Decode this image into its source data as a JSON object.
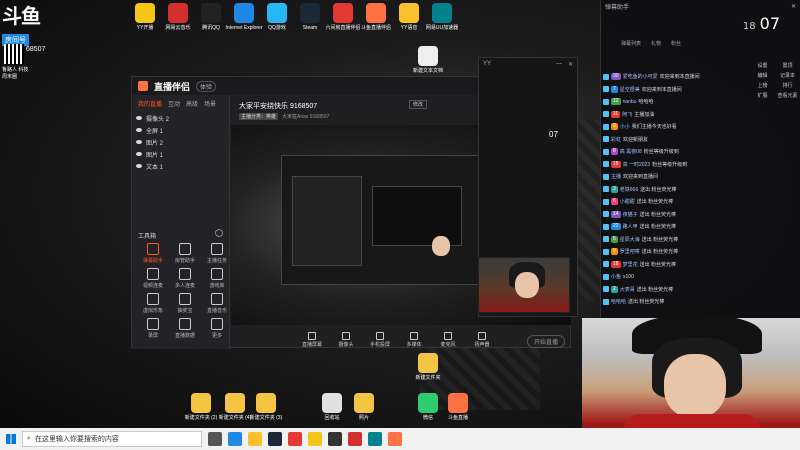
{
  "brand": {
    "logo": "斗鱼",
    "room_label": "房间号",
    "room_number": "68507",
    "sub1": "QQ音乐",
    "sub2": "鲁路人 科技",
    "sub3": "周末圈"
  },
  "desktop_icons": [
    {
      "label": "YY开播",
      "icon": "yy-icon",
      "color": "#f5c518"
    },
    {
      "label": "网易云音乐",
      "icon": "netease-music-icon",
      "color": "#d32f2f"
    },
    {
      "label": "腾讯QQ",
      "icon": "qq-icon",
      "color": "#222"
    },
    {
      "label": "Internet Explorer",
      "icon": "ie-icon",
      "color": "#1e88e5"
    },
    {
      "label": "QQ游戏",
      "icon": "qq-game-icon",
      "color": "#29b6f6"
    },
    {
      "label": "Steam",
      "icon": "steam-icon",
      "color": "#1b2838"
    },
    {
      "label": "六间房直播伴侣",
      "icon": "6rooms-icon",
      "color": "#e53935"
    },
    {
      "label": "斗鱼直播伴侣",
      "icon": "douyu-icon",
      "color": "#ff7043"
    },
    {
      "label": "YY语音",
      "icon": "yy-voice-icon",
      "color": "#fbc02d"
    },
    {
      "label": "网易UU加速器",
      "icon": "uu-icon",
      "color": "#00838f"
    }
  ],
  "desktop_file": "新建文本文档",
  "bottom_files": [
    {
      "label": "新建文件夹 (2)"
    },
    {
      "label": "新建文件夹 (4)"
    },
    {
      "label": "新建文件夹 (3)"
    },
    {
      "label": "回收站"
    },
    {
      "label": "照片"
    }
  ],
  "mid_files": [
    {
      "label": "新建文件夹"
    },
    {
      "label": "微信"
    },
    {
      "label": "斗鱼直播"
    }
  ],
  "main_window": {
    "app_title": "直播伴侣",
    "version": "体验",
    "scene_tabs": [
      "我的直播",
      "互动",
      "高级",
      "场景"
    ],
    "sources": [
      "摄像头 2",
      "全屏 1",
      "图片 2",
      "图片 1",
      "文本 1"
    ],
    "tools_header": "工具箱",
    "tools": [
      "弹幕助手",
      "房管助手",
      "主播任务",
      "视频连麦",
      "多人连麦",
      "游戏库",
      "虚拟形象",
      "抽奖宝",
      "直播音乐",
      "录屏",
      "直播数据",
      "更多"
    ],
    "room_title": "大家平安绕快乐 9168507",
    "room_edit": "修改",
    "room_tag": "主播分类：英雄",
    "room_meta": "大家庭Arias 9168507",
    "bottom_bar": [
      "直播屏幕",
      "摄像头",
      "手机投屏",
      "多媒体",
      "麦克风",
      "扬声器"
    ],
    "start_button": "开始直播"
  },
  "side_window": {
    "title": "YY",
    "counter": "07"
  },
  "chat": {
    "header": "弹幕助手",
    "clock_hour": "18",
    "clock_min": "07",
    "tabs": [
      "弹幕列表",
      "礼物",
      "粉丝"
    ],
    "tools": [
      "设置",
      "置顶",
      "编辑",
      "记录本",
      "上榜",
      "排行",
      "扩展",
      "查看元素"
    ],
    "messages": [
      {
        "badge": "30",
        "color": "#7e57c2",
        "name": "爱吃鱼的小可爱",
        "text": "欢迎来到本直播间"
      },
      {
        "badge": "7",
        "color": "#1e88e5",
        "name": "星空很美",
        "text": "欢迎来到本直播间"
      },
      {
        "badge": "12",
        "color": "#43a047",
        "name": "nanbu",
        "text": "哈哈哈"
      },
      {
        "badge": "11",
        "color": "#e53935",
        "name": "阿飞",
        "text": "主播加油"
      },
      {
        "badge": "9",
        "color": "#fb8c00",
        "name": "小小",
        "text": "我们主播今天也好看"
      },
      {
        "badge": "",
        "color": "#9e9e9e",
        "name": "彩虹",
        "text": "欢迎新朋友"
      },
      {
        "badge": "8",
        "color": "#ab47bc",
        "name": "高 黑夜08",
        "text": "粉丝等级升级到"
      },
      {
        "badge": "15",
        "color": "#e53935",
        "name": "高 一时2023",
        "text": "粉丝等级升级到"
      },
      {
        "badge": "",
        "color": "#607d8b",
        "name": "主播",
        "text": "欢迎来到直播间"
      },
      {
        "badge": "3",
        "color": "#26a69a",
        "name": "老铁666",
        "text": "送出 粉丝荧光棒"
      },
      {
        "badge": "6",
        "color": "#ec407a",
        "name": "小甜甜",
        "text": "送出 粉丝荧光棒"
      },
      {
        "badge": "14",
        "color": "#7e57c2",
        "name": "夜猫子",
        "text": "送出 粉丝荧光棒"
      },
      {
        "badge": "22",
        "color": "#1e88e5",
        "name": "路人甲",
        "text": "送出 粉丝荧光棒"
      },
      {
        "badge": "5",
        "color": "#43a047",
        "name": "星辰大海",
        "text": "送出 粉丝荧光棒"
      },
      {
        "badge": "9",
        "color": "#fb8c00",
        "name": "罗里吧嗦",
        "text": "送出 粉丝荧光棒"
      },
      {
        "badge": "18",
        "color": "#e53935",
        "name": "梦里花",
        "text": "送出 粉丝荧光棒"
      },
      {
        "badge": "",
        "color": "#9e9e9e",
        "name": "小鱼",
        "text": "x100"
      },
      {
        "badge": "2",
        "color": "#26a69a",
        "name": "大表哥",
        "text": "送出 粉丝荧光棒"
      },
      {
        "badge": "",
        "color": "#607d8b",
        "name": "哈哈哈",
        "text": "送出 粉丝荧光棒"
      }
    ]
  },
  "taskbar": {
    "search_placeholder": "在这里输入你要搜索的内容",
    "apps": [
      {
        "icon": "task-view-icon",
        "color": "#555"
      },
      {
        "icon": "edge-icon",
        "color": "#1e88e5"
      },
      {
        "icon": "explorer-icon",
        "color": "#fbc02d"
      },
      {
        "icon": "steam-task-icon",
        "color": "#1b2838"
      },
      {
        "icon": "6rooms-task-icon",
        "color": "#e53935"
      },
      {
        "icon": "yy-task-icon",
        "color": "#f5c518"
      },
      {
        "icon": "obs-task-icon",
        "color": "#333"
      },
      {
        "icon": "music-task-icon",
        "color": "#d32f2f"
      },
      {
        "icon": "uu-task-icon",
        "color": "#00838f"
      },
      {
        "icon": "douyu-task-icon",
        "color": "#ff7043"
      }
    ]
  }
}
